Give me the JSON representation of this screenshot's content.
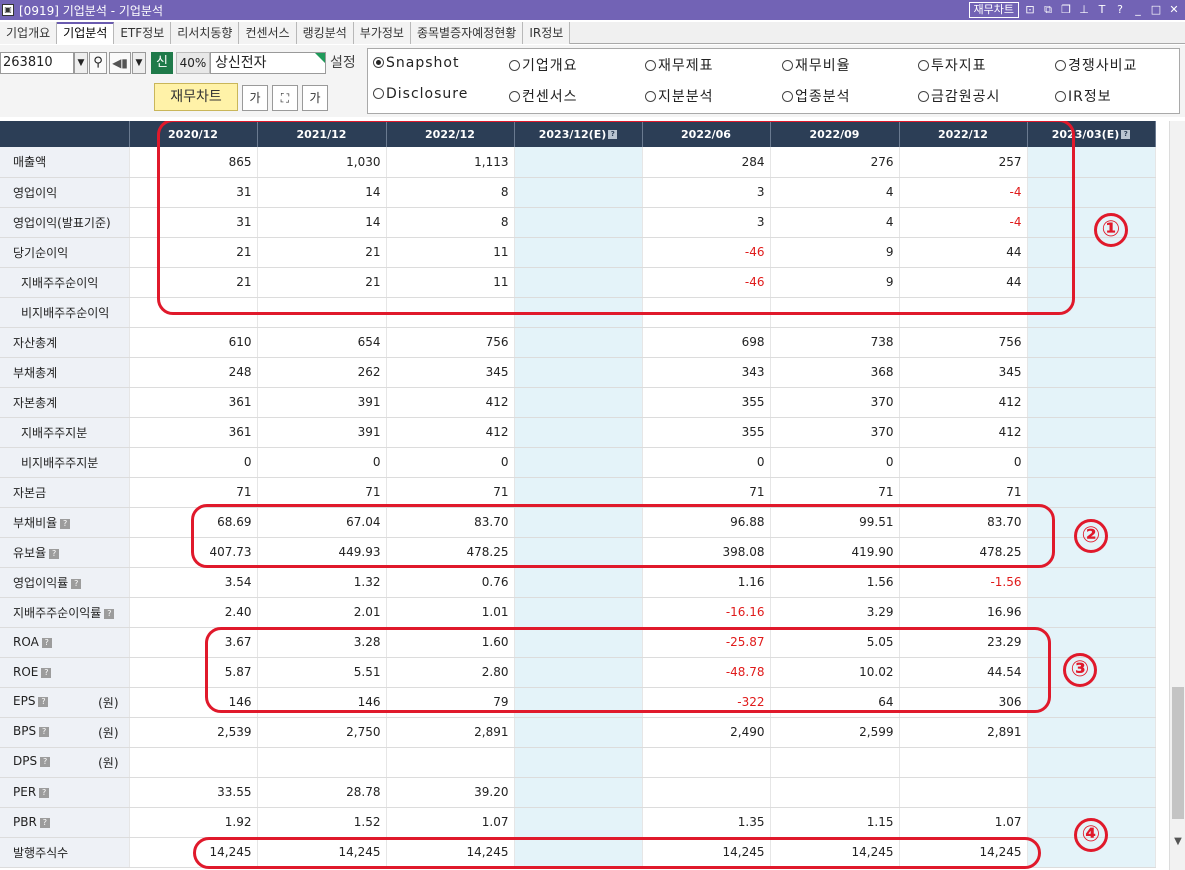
{
  "window": {
    "title": "[0919] 기업분석 - 기업분석",
    "chart_button": "재무차트",
    "icons": [
      "chart-icon",
      "restore-icon",
      "copy-icon",
      "pin-icon",
      "font-icon",
      "help-icon",
      "minimize-icon",
      "maximize-icon",
      "close-icon"
    ]
  },
  "tabs": [
    "기업개요",
    "기업분석",
    "ETF정보",
    "리서치동향",
    "컨센서스",
    "랭킹분석",
    "부가정보",
    "종목별증자예정현황",
    "IR정보"
  ],
  "active_tab": "기업분석",
  "toolbar": {
    "code": "263810",
    "credit_badge": "신",
    "margin_pct": "40%",
    "stock_name": "상신전자",
    "setting_label": "설정",
    "chart_button": "재무차트",
    "font_small": "가",
    "font_large": "가"
  },
  "radios": [
    {
      "label": "Snapshot",
      "checked": true
    },
    {
      "label": "기업개요",
      "checked": false
    },
    {
      "label": "재무제표",
      "checked": false
    },
    {
      "label": "재무비율",
      "checked": false
    },
    {
      "label": "투자지표",
      "checked": false
    },
    {
      "label": "경쟁사비교",
      "checked": false
    },
    {
      "label": "Disclosure",
      "checked": false
    },
    {
      "label": "컨센서스",
      "checked": false
    },
    {
      "label": "지분분석",
      "checked": false
    },
    {
      "label": "업종분석",
      "checked": false
    },
    {
      "label": "금감원공시",
      "checked": false
    },
    {
      "label": "IR정보",
      "checked": false
    }
  ],
  "table": {
    "columns": [
      "2020/12",
      "2021/12",
      "2022/12",
      "2023/12(E)",
      "2022/06",
      "2022/09",
      "2022/12",
      "2023/03(E)"
    ],
    "estimate_columns": [
      3,
      7
    ],
    "rows": [
      {
        "label": "매출액",
        "values": [
          "865",
          "1,030",
          "1,113",
          "",
          "284",
          "276",
          "257",
          ""
        ]
      },
      {
        "label": "영업이익",
        "values": [
          "31",
          "14",
          "8",
          "",
          "3",
          "4",
          "-4",
          ""
        ]
      },
      {
        "label": "영업이익(발표기준)",
        "values": [
          "31",
          "14",
          "8",
          "",
          "3",
          "4",
          "-4",
          ""
        ]
      },
      {
        "label": "당기순이익",
        "values": [
          "21",
          "21",
          "11",
          "",
          "-46",
          "9",
          "44",
          ""
        ]
      },
      {
        "label": "지배주주순이익",
        "sub": true,
        "values": [
          "21",
          "21",
          "11",
          "",
          "-46",
          "9",
          "44",
          ""
        ]
      },
      {
        "label": "비지배주주순이익",
        "sub": true,
        "values": [
          "",
          "",
          "",
          "",
          "",
          "",
          "",
          ""
        ]
      },
      {
        "label": "자산총계",
        "values": [
          "610",
          "654",
          "756",
          "",
          "698",
          "738",
          "756",
          ""
        ]
      },
      {
        "label": "부채총계",
        "values": [
          "248",
          "262",
          "345",
          "",
          "343",
          "368",
          "345",
          ""
        ]
      },
      {
        "label": "자본총계",
        "values": [
          "361",
          "391",
          "412",
          "",
          "355",
          "370",
          "412",
          ""
        ]
      },
      {
        "label": "지배주주지분",
        "sub": true,
        "values": [
          "361",
          "391",
          "412",
          "",
          "355",
          "370",
          "412",
          ""
        ]
      },
      {
        "label": "비지배주주지분",
        "sub": true,
        "values": [
          "0",
          "0",
          "0",
          "",
          "0",
          "0",
          "0",
          ""
        ]
      },
      {
        "label": "자본금",
        "values": [
          "71",
          "71",
          "71",
          "",
          "71",
          "71",
          "71",
          ""
        ]
      },
      {
        "label": "부채비율",
        "help": true,
        "values": [
          "68.69",
          "67.04",
          "83.70",
          "",
          "96.88",
          "99.51",
          "83.70",
          ""
        ]
      },
      {
        "label": "유보율",
        "help": true,
        "values": [
          "407.73",
          "449.93",
          "478.25",
          "",
          "398.08",
          "419.90",
          "478.25",
          ""
        ]
      },
      {
        "label": "영업이익률",
        "help": true,
        "values": [
          "3.54",
          "1.32",
          "0.76",
          "",
          "1.16",
          "1.56",
          "-1.56",
          ""
        ]
      },
      {
        "label": "지배주주순이익률",
        "help": true,
        "values": [
          "2.40",
          "2.01",
          "1.01",
          "",
          "-16.16",
          "3.29",
          "16.96",
          ""
        ]
      },
      {
        "label": "ROA",
        "help": true,
        "values": [
          "3.67",
          "3.28",
          "1.60",
          "",
          "-25.87",
          "5.05",
          "23.29",
          ""
        ]
      },
      {
        "label": "ROE",
        "help": true,
        "values": [
          "5.87",
          "5.51",
          "2.80",
          "",
          "-48.78",
          "10.02",
          "44.54",
          ""
        ]
      },
      {
        "label": "EPS",
        "help": true,
        "unit": "(원)",
        "values": [
          "146",
          "146",
          "79",
          "",
          "-322",
          "64",
          "306",
          ""
        ]
      },
      {
        "label": "BPS",
        "help": true,
        "unit": "(원)",
        "values": [
          "2,539",
          "2,750",
          "2,891",
          "",
          "2,490",
          "2,599",
          "2,891",
          ""
        ]
      },
      {
        "label": "DPS",
        "help": true,
        "unit": "(원)",
        "values": [
          "",
          "",
          "",
          "",
          "",
          "",
          "",
          ""
        ]
      },
      {
        "label": "PER",
        "help": true,
        "values": [
          "33.55",
          "28.78",
          "39.20",
          "",
          "",
          "",
          "",
          ""
        ]
      },
      {
        "label": "PBR",
        "help": true,
        "values": [
          "1.92",
          "1.52",
          "1.07",
          "",
          "1.35",
          "1.15",
          "1.07",
          ""
        ]
      },
      {
        "label": "발행주식수",
        "values": [
          "14,245",
          "14,245",
          "14,245",
          "",
          "14,245",
          "14,245",
          "14,245",
          ""
        ]
      }
    ]
  },
  "annotations": {
    "highlight_color": "#e0192b",
    "numbers": [
      "①",
      "②",
      "③",
      "④"
    ]
  },
  "colors": {
    "titlebar": "#7263b5",
    "header": "#2c3e56",
    "estimate_column": "#e4f3f9",
    "negative": "#e01b1b",
    "chart_button": "#fff2a8"
  }
}
